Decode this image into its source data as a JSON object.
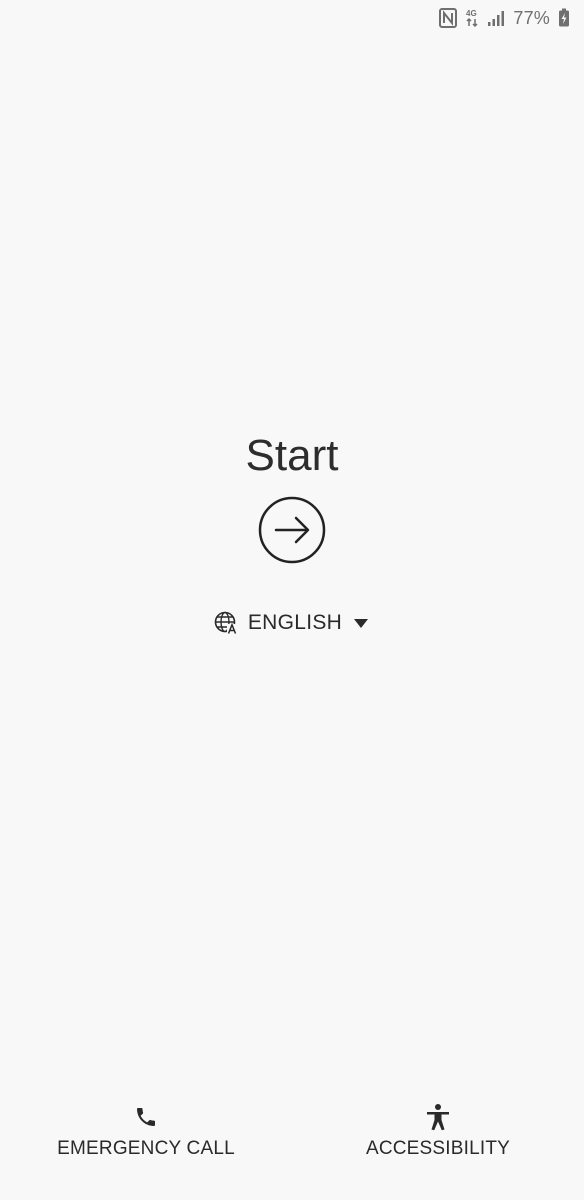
{
  "status_bar": {
    "icons": [
      "nfc-icon",
      "data-icon",
      "signal-icon",
      "battery-icon"
    ],
    "battery_percent": "77%"
  },
  "start": {
    "title": "Start",
    "button_icon": "arrow-right-circle-icon"
  },
  "language": {
    "icon": "globe-language-icon",
    "selected": "ENGLISH",
    "dropdown_icon": "dropdown-triangle-icon"
  },
  "bottom_actions": {
    "emergency_call": {
      "label": "EMERGENCY CALL",
      "icon": "phone-icon"
    },
    "accessibility": {
      "label": "ACCESSIBILITY",
      "icon": "accessibility-icon"
    }
  },
  "colors": {
    "background": "#f8f8f8",
    "text": "#2a2a2a",
    "status_gray": "#6f6f6f"
  }
}
